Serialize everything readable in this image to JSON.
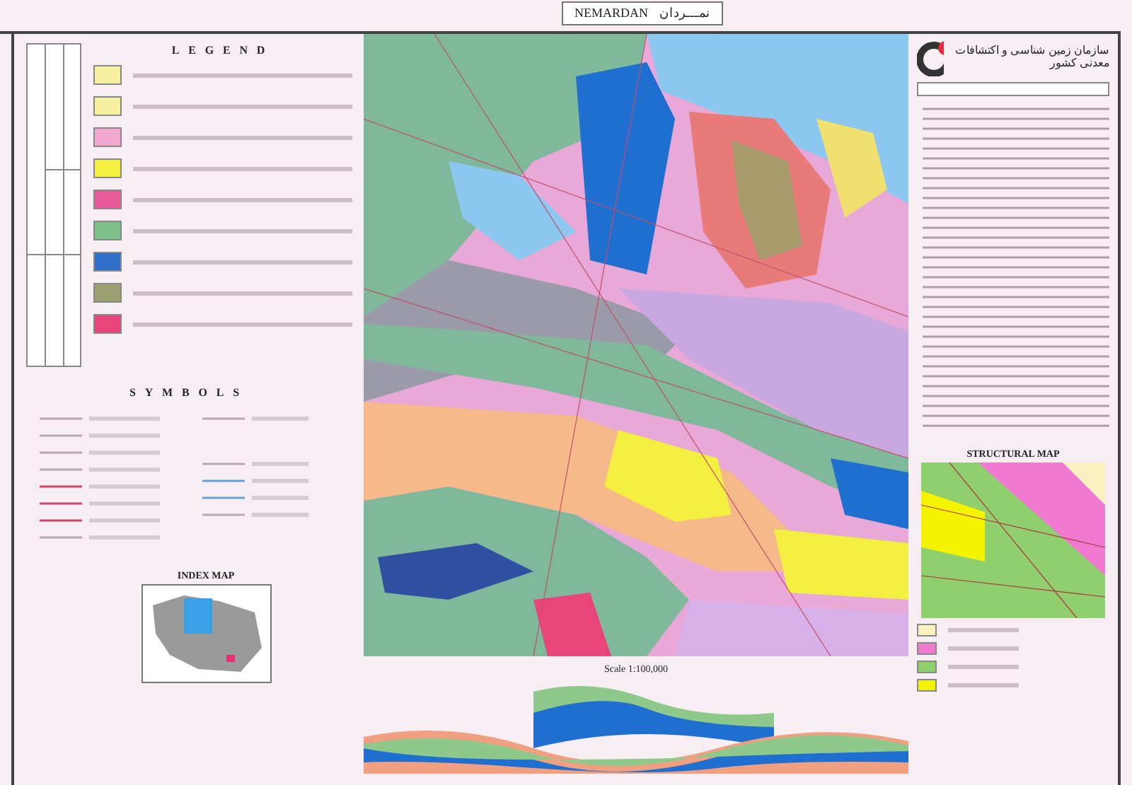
{
  "title": {
    "latin": "NEMARDAN",
    "persian": "نمـــردان"
  },
  "legend": {
    "heading": "LEGEND",
    "units": [
      {
        "color": "#f6f0a0"
      },
      {
        "color": "#f6f0a0"
      },
      {
        "color": "#f0a8d0"
      },
      {
        "color": "#f3ef40"
      },
      {
        "color": "#e85a9a"
      },
      {
        "color": "#7fc08a"
      },
      {
        "color": "#2f6fc8"
      },
      {
        "color": "#9aa070"
      },
      {
        "color": "#e8457a"
      }
    ]
  },
  "symbols": {
    "heading": "SYMBOLS"
  },
  "index_map": {
    "title": "INDEX MAP"
  },
  "publisher": {
    "name": "سازمان زمین شناسی و اکتشافات معدنی کشور"
  },
  "scale": "Scale 1:100,000",
  "structural_map": {
    "title": "STRUCTURAL MAP",
    "units": [
      {
        "color": "#fbf0c0"
      },
      {
        "color": "#f07ad0"
      },
      {
        "color": "#8fcf6e"
      },
      {
        "color": "#f4f400"
      }
    ]
  }
}
